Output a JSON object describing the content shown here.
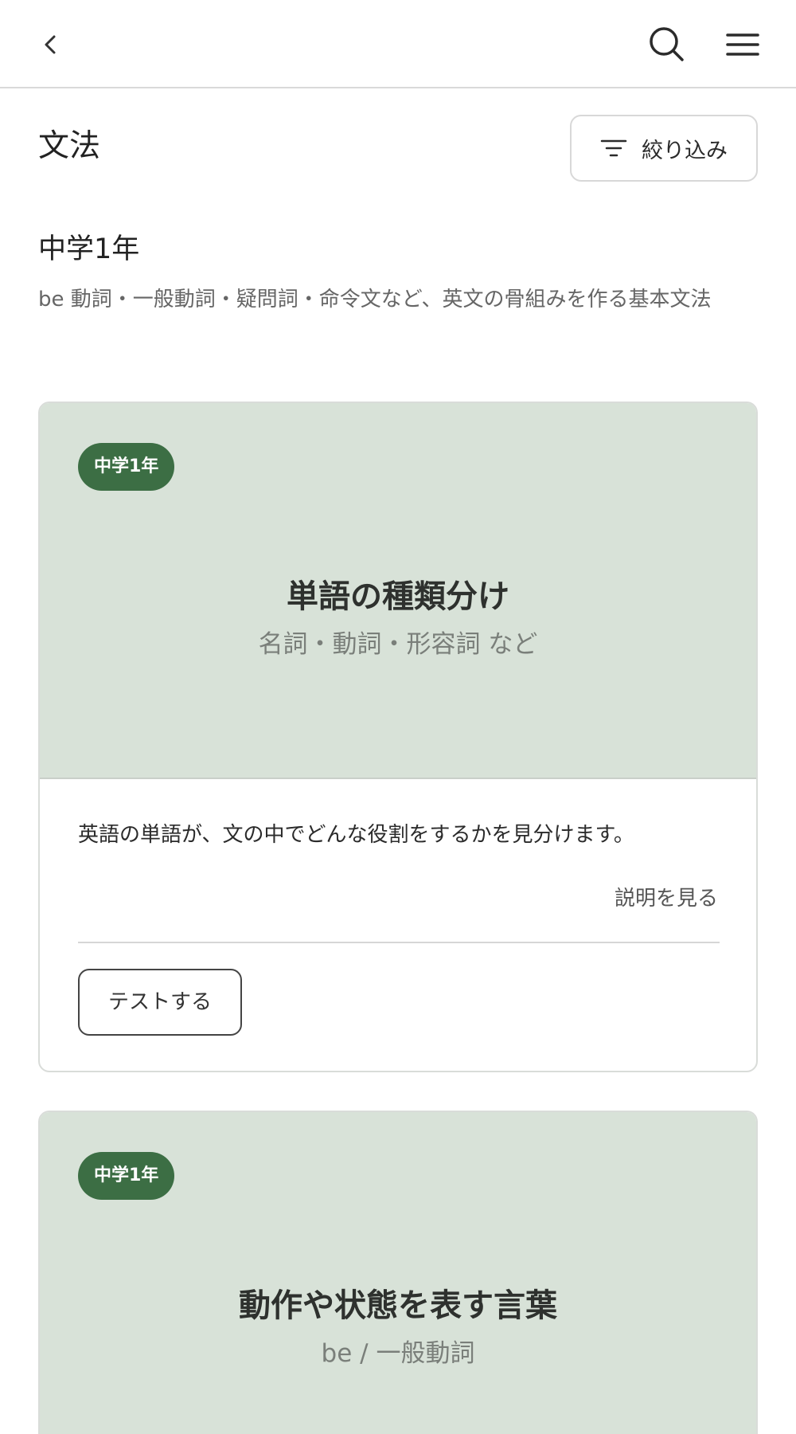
{
  "header": {
    "back_icon": "chevron-left-icon",
    "search_icon": "search-icon",
    "menu_icon": "hamburger-menu-icon"
  },
  "page": {
    "title": "文法",
    "filter_label": "絞り込み",
    "filter_icon": "filter-lines-icon"
  },
  "section": {
    "title": "中学1年",
    "description": "be 動詞・一般動詞・疑問詞・命令文など、英文の骨組みを作る基本文法"
  },
  "cards": [
    {
      "badge": "中学1年",
      "title": "単語の種類分け",
      "subtitle": "名詞・動詞・形容詞 など",
      "description": "英語の単語が、文の中でどんな役割をするかを見分けます。",
      "explain_label": "説明を見る",
      "test_label": "テストする"
    },
    {
      "badge": "中学1年",
      "title": "動作や状態を表す言葉",
      "subtitle": "be / 一般動詞"
    }
  ],
  "colors": {
    "badge_bg": "#3c6e44",
    "card_hero_bg": "#d8e2d8",
    "divider": "#d9d9d9"
  }
}
